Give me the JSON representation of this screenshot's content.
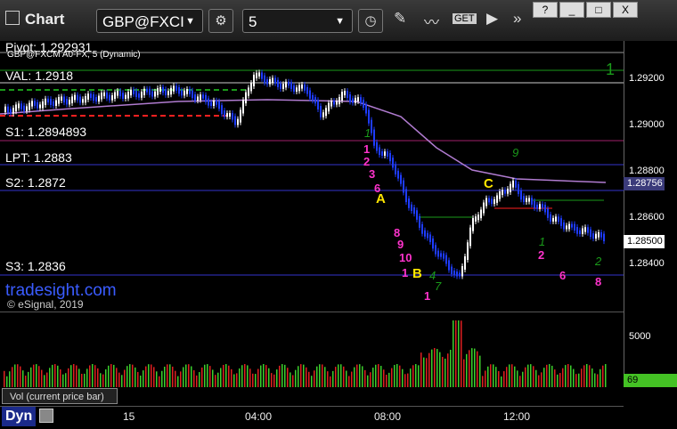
{
  "window": {
    "title": "Chart",
    "symbol": "GBP@FXCI",
    "interval": "5",
    "controls": [
      "?",
      "_",
      "□",
      "X"
    ]
  },
  "study_label": "GBP@FXCM A0-FX, 5 (Dynamic)",
  "levels": {
    "pivot": "Pivot: 1.2929",
    "pivot_extra": "31",
    "val": "VAL: 1.2918",
    "s1": "S1: 1.2894",
    "s1_extra": "893",
    "lpt": "LPT: 1.2883",
    "s2": "S2: 1.2872",
    "s3": "S3: 1.2836"
  },
  "watermark": {
    "brand": "tradesight.com",
    "copyright": "© eSignal, 2019"
  },
  "price_axis": {
    "ticks": [
      "1.29200",
      "1.29000",
      "1.28800",
      "1.28600",
      "1.28400"
    ],
    "current_price": "1.28500",
    "highlight_price": "1.28756",
    "top_marker": "1"
  },
  "volume_axis": {
    "tick": "5000",
    "current": "69"
  },
  "volume_tab": "Vol (current price bar)",
  "time_axis": [
    "15",
    "04:00",
    "08:00",
    "12:00"
  ],
  "bottom_label": "Dyn",
  "annotations": {
    "letters": [
      "A",
      "B",
      "C"
    ],
    "counts_magenta": [
      "1",
      "2",
      "3",
      "6",
      "8",
      "9",
      "10",
      "1",
      "1",
      "2",
      "6",
      "8"
    ],
    "counts_green": [
      "1",
      "4",
      "7",
      "9",
      "1",
      "2"
    ]
  },
  "colors": {
    "up_bar": "#ffffff",
    "down_bar": "#1e3cff",
    "val_line": "#1a9a1a",
    "level_line": "#3333cc",
    "red_line": "#ff2020",
    "ma": "#b07bd0",
    "letters": "#ffe600",
    "counts": "#ff33cc"
  }
}
